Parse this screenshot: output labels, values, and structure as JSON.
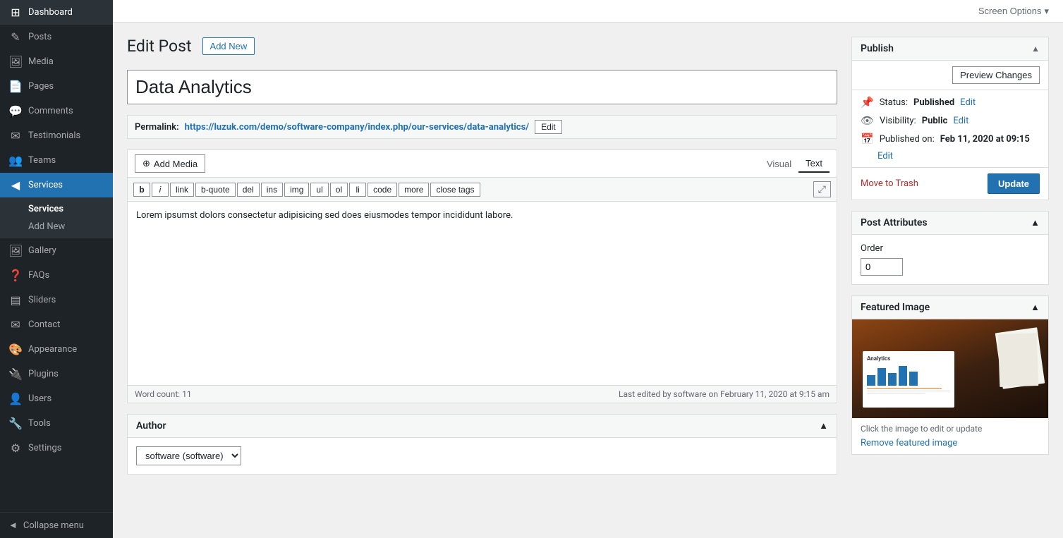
{
  "sidebar": {
    "items": [
      {
        "label": "Dashboard",
        "icon": "⊞",
        "name": "dashboard"
      },
      {
        "label": "Posts",
        "icon": "✎",
        "name": "posts"
      },
      {
        "label": "Media",
        "icon": "🖼",
        "name": "media"
      },
      {
        "label": "Pages",
        "icon": "📄",
        "name": "pages"
      },
      {
        "label": "Comments",
        "icon": "💬",
        "name": "comments"
      },
      {
        "label": "Testimonials",
        "icon": "✉",
        "name": "testimonials"
      },
      {
        "label": "Teams",
        "icon": "👥",
        "name": "teams"
      },
      {
        "label": "Services",
        "icon": "◀",
        "name": "services"
      },
      {
        "label": "Gallery",
        "icon": "🖼",
        "name": "gallery"
      },
      {
        "label": "FAQs",
        "icon": "❓",
        "name": "faqs"
      },
      {
        "label": "Sliders",
        "icon": "▤",
        "name": "sliders"
      },
      {
        "label": "Contact",
        "icon": "✉",
        "name": "contact"
      },
      {
        "label": "Appearance",
        "icon": "🎨",
        "name": "appearance"
      },
      {
        "label": "Plugins",
        "icon": "🔌",
        "name": "plugins"
      },
      {
        "label": "Users",
        "icon": "👤",
        "name": "users"
      },
      {
        "label": "Tools",
        "icon": "🔧",
        "name": "tools"
      },
      {
        "label": "Settings",
        "icon": "⚙",
        "name": "settings"
      }
    ],
    "services_sub": [
      {
        "label": "Services",
        "name": "services-menu"
      },
      {
        "label": "Add New",
        "name": "add-new-menu"
      }
    ],
    "collapse_label": "Collapse menu"
  },
  "topbar": {
    "screen_options_label": "Screen Options"
  },
  "page_header": {
    "title": "Edit Post",
    "add_new_label": "Add New"
  },
  "post": {
    "title": "Data Analytics",
    "permalink_label": "Permalink:",
    "permalink_url": "https://luzuk.com/demo/software-company/index.php/our-services/",
    "permalink_slug": "data-analytics/",
    "edit_permalink_label": "Edit",
    "content": "Lorem ipsumst dolors consectetur adipisicing sed does eiusmodes tempor incididunt labore."
  },
  "editor": {
    "add_media_label": "Add Media",
    "visual_label": "Visual",
    "text_label": "Text",
    "format_buttons": [
      "b",
      "i",
      "link",
      "b-quote",
      "del",
      "ins",
      "img",
      "ul",
      "ol",
      "li",
      "code",
      "more",
      "close tags"
    ],
    "word_count_label": "Word count: 11",
    "last_edited": "Last edited by software on February 11, 2020 at 9:15 am"
  },
  "author_box": {
    "title": "Author",
    "author_value": "software (software)"
  },
  "publish_box": {
    "title": "Publish",
    "preview_changes_label": "Preview Changes",
    "status_label": "Status:",
    "status_value": "Published",
    "status_edit_label": "Edit",
    "visibility_label": "Visibility:",
    "visibility_value": "Public",
    "visibility_edit_label": "Edit",
    "published_label": "Published on:",
    "published_value": "Feb 11, 2020 at 09:15",
    "published_edit_label": "Edit",
    "move_trash_label": "Move to Trash",
    "update_label": "Update"
  },
  "post_attributes": {
    "title": "Post Attributes",
    "order_label": "Order",
    "order_value": "0"
  },
  "featured_image": {
    "title": "Featured Image",
    "click_to_edit": "Click the image to edit or update",
    "remove_label": "Remove featured image"
  }
}
